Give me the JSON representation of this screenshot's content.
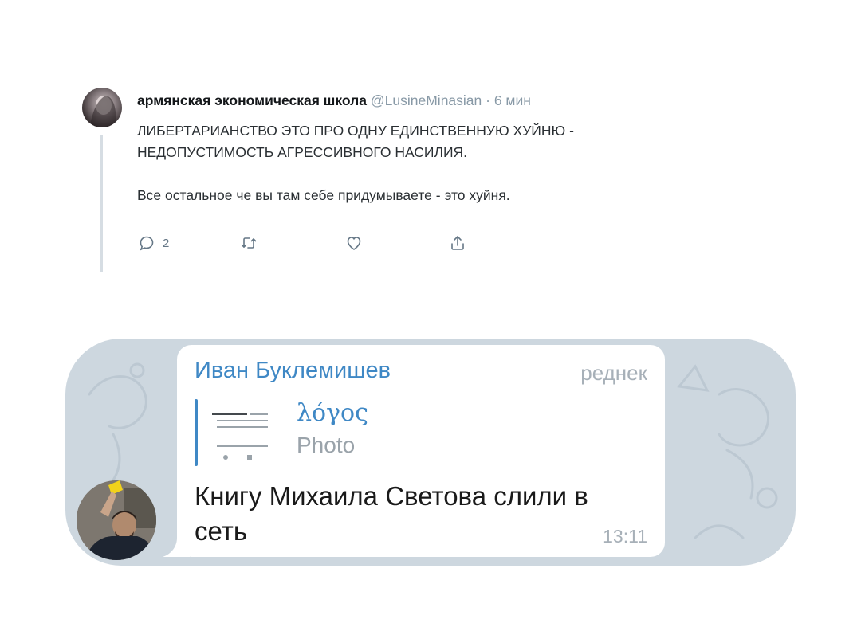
{
  "tweet": {
    "display_name": "армянская экономическая школа",
    "handle": "@LusineMinasian",
    "time": "· 6 мин",
    "lines": [
      "ЛИБЕРТАРИАНСТВО ЭТО ПРО ОДНУ ЕДИНСТВЕННУЮ ХУЙНЮ -",
      "НЕДОПУСТИМОСТЬ АГРЕССИВНОГО НАСИЛИЯ.",
      "Все остальное че вы там себе придумываете - это хуйня."
    ],
    "actions": {
      "reply_count": "2",
      "icons": [
        "reply-icon",
        "retweet-icon",
        "like-icon",
        "share-icon"
      ]
    }
  },
  "telegram": {
    "sender": "Иван Буклемишев",
    "tag": "реднек",
    "reply": {
      "title": "λόγος",
      "subtitle": "Photo"
    },
    "message_lines": [
      "Книгу Михаила Светова слили в",
      "сеть"
    ],
    "time": "13:11",
    "colors": {
      "accent": "#3f88c5",
      "background": "#cdd7df"
    }
  }
}
